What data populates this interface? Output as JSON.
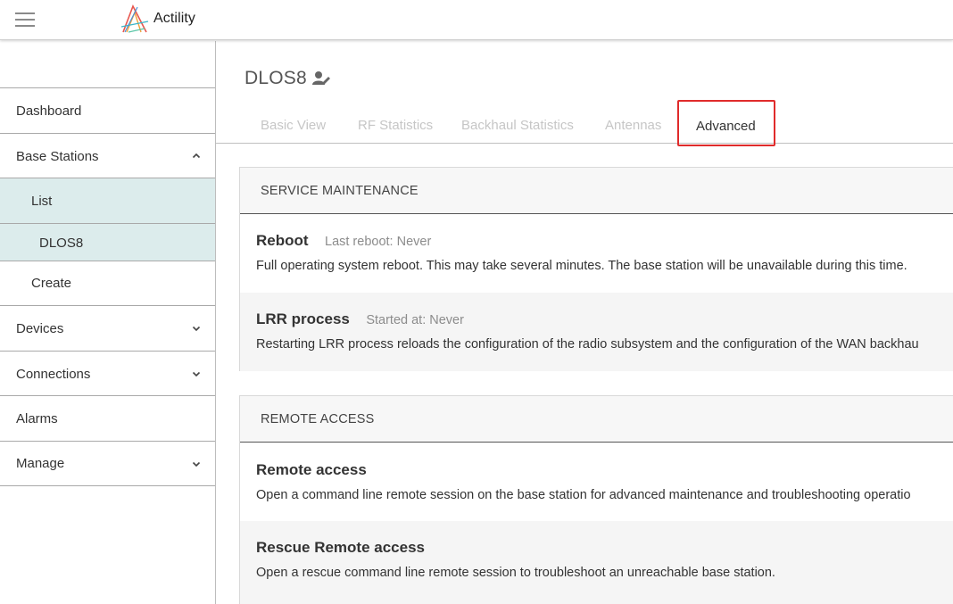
{
  "brand": {
    "name": "Actility"
  },
  "sidebar": {
    "items": [
      {
        "label": "Dashboard",
        "level": 0,
        "chevron": "none"
      },
      {
        "label": "Base Stations",
        "level": 0,
        "chevron": "up"
      },
      {
        "label": "List",
        "level": 1,
        "chevron": "none",
        "highlighted": true
      },
      {
        "label": "DLOS8",
        "level": 2,
        "chevron": "none",
        "highlighted": true
      },
      {
        "label": "Create",
        "level": 1,
        "chevron": "none"
      },
      {
        "label": "Devices",
        "level": 0,
        "chevron": "down"
      },
      {
        "label": "Connections",
        "level": 0,
        "chevron": "down"
      },
      {
        "label": "Alarms",
        "level": 0,
        "chevron": "none"
      },
      {
        "label": "Manage",
        "level": 0,
        "chevron": "down"
      }
    ]
  },
  "page": {
    "title": "DLOS8",
    "title_icon": "user-edit-icon"
  },
  "tabs": [
    {
      "label": "Basic View",
      "active": false
    },
    {
      "label": "RF Statistics",
      "active": false
    },
    {
      "label": "Backhaul Statistics",
      "active": false
    },
    {
      "label": "Antennas",
      "active": false
    },
    {
      "label": "Advanced",
      "active": true
    }
  ],
  "sections": {
    "service_maintenance": {
      "header": "SERVICE MAINTENANCE",
      "reboot": {
        "title": "Reboot",
        "meta": "Last reboot: Never",
        "desc": "Full operating system reboot. This may take several minutes. The base station will be unavailable during this time."
      },
      "lrr": {
        "title": "LRR process",
        "meta": "Started at: Never",
        "desc": "Restarting LRR process reloads the configuration of the radio subsystem and the configuration of the WAN backhau"
      }
    },
    "remote_access": {
      "header": "REMOTE ACCESS",
      "remote": {
        "title": "Remote access",
        "desc": "Open a command line remote session on the base station for advanced maintenance and troubleshooting operatio"
      },
      "rescue": {
        "title": "Rescue Remote access",
        "desc": "Open a rescue command line remote session to troubleshoot an unreachable base station."
      }
    }
  },
  "colors": {
    "highlight_bg": "#dcecec",
    "annotation_red": "#e02b2b"
  }
}
